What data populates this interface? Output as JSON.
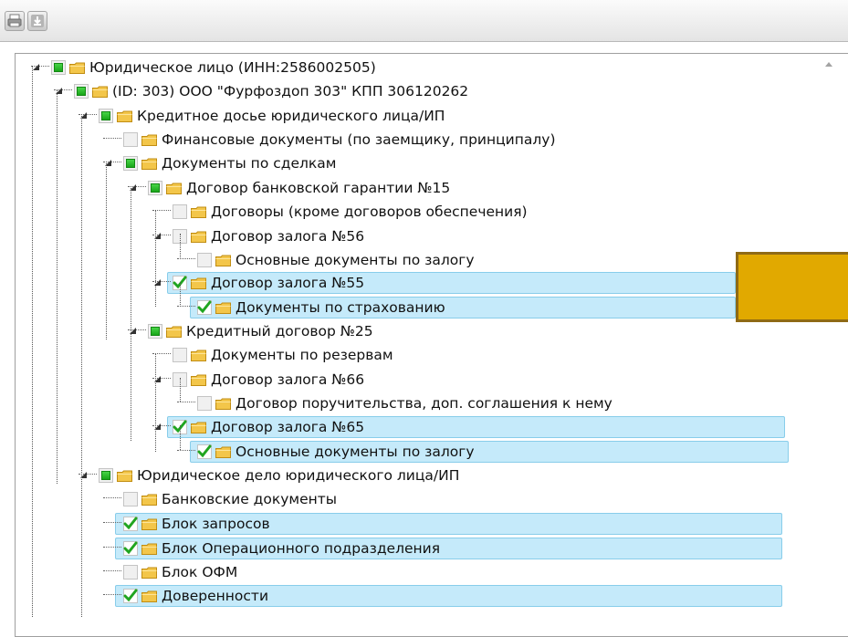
{
  "toolbar": {
    "print_icon": "printer-icon",
    "download_icon": "download-icon"
  },
  "colors": {
    "highlight": "#c5eafa",
    "checkbox_green": "#19a619",
    "folder": "#f3c64a",
    "orange_box": "#e1a900"
  },
  "tree": [
    {
      "label": "Юридическое лицо (ИНН:2586002505)",
      "state": "partial",
      "expanded": true
    },
    {
      "label": "(ID: 303) ООО \"Фурфоздоп 303\" КПП 306120262",
      "state": "partial",
      "expanded": true
    },
    {
      "label": "Кредитное досье юридического лица/ИП",
      "state": "partial",
      "expanded": true
    },
    {
      "label": "Финансовые документы (по заемщику, принципалу)",
      "state": "unchecked",
      "expanded": false
    },
    {
      "label": "Документы по сделкам",
      "state": "partial",
      "expanded": true
    },
    {
      "label": "Договор банковской гарантии №15",
      "state": "partial",
      "expanded": true
    },
    {
      "label": "Договоры (кроме договоров обеспечения)",
      "state": "unchecked",
      "expanded": false
    },
    {
      "label": "Договор залога №56",
      "state": "unchecked",
      "expanded": true
    },
    {
      "label": "Основные документы по залогу",
      "state": "unchecked",
      "expanded": false
    },
    {
      "label": "Договор залога №55",
      "state": "checked",
      "expanded": true
    },
    {
      "label": "Документы по страхованию",
      "state": "checked",
      "expanded": false
    },
    {
      "label": "Кредитный договор №25",
      "state": "partial",
      "expanded": true
    },
    {
      "label": "Документы по резервам",
      "state": "unchecked",
      "expanded": false
    },
    {
      "label": "Договор залога №66",
      "state": "unchecked",
      "expanded": true
    },
    {
      "label": "Договор поручительства, доп. соглашения к нему",
      "state": "unchecked",
      "expanded": false
    },
    {
      "label": "Договор залога №65",
      "state": "checked",
      "expanded": true
    },
    {
      "label": "Основные документы по залогу",
      "state": "checked",
      "expanded": false
    },
    {
      "label": "Юридическое дело юридического лица/ИП",
      "state": "partial",
      "expanded": true
    },
    {
      "label": "Банковские документы",
      "state": "unchecked",
      "expanded": false
    },
    {
      "label": "Блок запросов",
      "state": "checked",
      "expanded": false
    },
    {
      "label": "Блок Операционного подразделения",
      "state": "checked",
      "expanded": false
    },
    {
      "label": "Блок ОФМ",
      "state": "unchecked",
      "expanded": false
    },
    {
      "label": "Доверенности",
      "state": "checked",
      "expanded": false
    }
  ]
}
